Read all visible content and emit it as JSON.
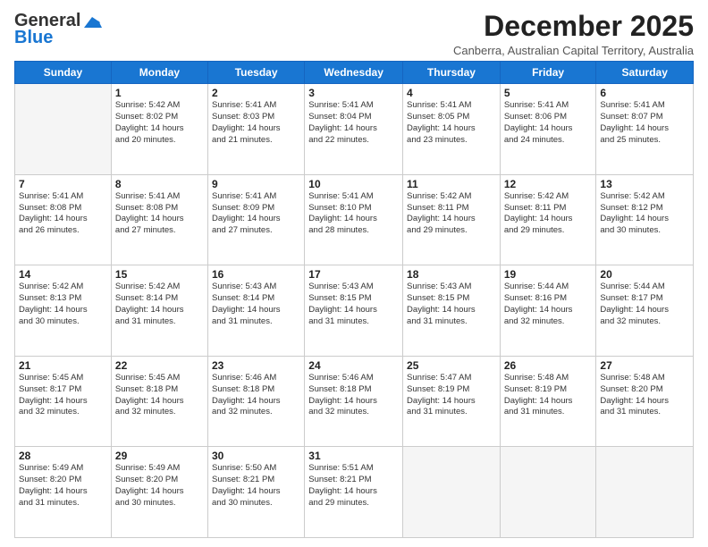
{
  "logo": {
    "line1": "General",
    "line2": "Blue"
  },
  "title": "December 2025",
  "subtitle": "Canberra, Australian Capital Territory, Australia",
  "days_header": [
    "Sunday",
    "Monday",
    "Tuesday",
    "Wednesday",
    "Thursday",
    "Friday",
    "Saturday"
  ],
  "weeks": [
    [
      {
        "day": "",
        "info": ""
      },
      {
        "day": "1",
        "info": "Sunrise: 5:42 AM\nSunset: 8:02 PM\nDaylight: 14 hours\nand 20 minutes."
      },
      {
        "day": "2",
        "info": "Sunrise: 5:41 AM\nSunset: 8:03 PM\nDaylight: 14 hours\nand 21 minutes."
      },
      {
        "day": "3",
        "info": "Sunrise: 5:41 AM\nSunset: 8:04 PM\nDaylight: 14 hours\nand 22 minutes."
      },
      {
        "day": "4",
        "info": "Sunrise: 5:41 AM\nSunset: 8:05 PM\nDaylight: 14 hours\nand 23 minutes."
      },
      {
        "day": "5",
        "info": "Sunrise: 5:41 AM\nSunset: 8:06 PM\nDaylight: 14 hours\nand 24 minutes."
      },
      {
        "day": "6",
        "info": "Sunrise: 5:41 AM\nSunset: 8:07 PM\nDaylight: 14 hours\nand 25 minutes."
      }
    ],
    [
      {
        "day": "7",
        "info": "Sunrise: 5:41 AM\nSunset: 8:08 PM\nDaylight: 14 hours\nand 26 minutes."
      },
      {
        "day": "8",
        "info": "Sunrise: 5:41 AM\nSunset: 8:08 PM\nDaylight: 14 hours\nand 27 minutes."
      },
      {
        "day": "9",
        "info": "Sunrise: 5:41 AM\nSunset: 8:09 PM\nDaylight: 14 hours\nand 27 minutes."
      },
      {
        "day": "10",
        "info": "Sunrise: 5:41 AM\nSunset: 8:10 PM\nDaylight: 14 hours\nand 28 minutes."
      },
      {
        "day": "11",
        "info": "Sunrise: 5:42 AM\nSunset: 8:11 PM\nDaylight: 14 hours\nand 29 minutes."
      },
      {
        "day": "12",
        "info": "Sunrise: 5:42 AM\nSunset: 8:11 PM\nDaylight: 14 hours\nand 29 minutes."
      },
      {
        "day": "13",
        "info": "Sunrise: 5:42 AM\nSunset: 8:12 PM\nDaylight: 14 hours\nand 30 minutes."
      }
    ],
    [
      {
        "day": "14",
        "info": "Sunrise: 5:42 AM\nSunset: 8:13 PM\nDaylight: 14 hours\nand 30 minutes."
      },
      {
        "day": "15",
        "info": "Sunrise: 5:42 AM\nSunset: 8:14 PM\nDaylight: 14 hours\nand 31 minutes."
      },
      {
        "day": "16",
        "info": "Sunrise: 5:43 AM\nSunset: 8:14 PM\nDaylight: 14 hours\nand 31 minutes."
      },
      {
        "day": "17",
        "info": "Sunrise: 5:43 AM\nSunset: 8:15 PM\nDaylight: 14 hours\nand 31 minutes."
      },
      {
        "day": "18",
        "info": "Sunrise: 5:43 AM\nSunset: 8:15 PM\nDaylight: 14 hours\nand 31 minutes."
      },
      {
        "day": "19",
        "info": "Sunrise: 5:44 AM\nSunset: 8:16 PM\nDaylight: 14 hours\nand 32 minutes."
      },
      {
        "day": "20",
        "info": "Sunrise: 5:44 AM\nSunset: 8:17 PM\nDaylight: 14 hours\nand 32 minutes."
      }
    ],
    [
      {
        "day": "21",
        "info": "Sunrise: 5:45 AM\nSunset: 8:17 PM\nDaylight: 14 hours\nand 32 minutes."
      },
      {
        "day": "22",
        "info": "Sunrise: 5:45 AM\nSunset: 8:18 PM\nDaylight: 14 hours\nand 32 minutes."
      },
      {
        "day": "23",
        "info": "Sunrise: 5:46 AM\nSunset: 8:18 PM\nDaylight: 14 hours\nand 32 minutes."
      },
      {
        "day": "24",
        "info": "Sunrise: 5:46 AM\nSunset: 8:18 PM\nDaylight: 14 hours\nand 32 minutes."
      },
      {
        "day": "25",
        "info": "Sunrise: 5:47 AM\nSunset: 8:19 PM\nDaylight: 14 hours\nand 31 minutes."
      },
      {
        "day": "26",
        "info": "Sunrise: 5:48 AM\nSunset: 8:19 PM\nDaylight: 14 hours\nand 31 minutes."
      },
      {
        "day": "27",
        "info": "Sunrise: 5:48 AM\nSunset: 8:20 PM\nDaylight: 14 hours\nand 31 minutes."
      }
    ],
    [
      {
        "day": "28",
        "info": "Sunrise: 5:49 AM\nSunset: 8:20 PM\nDaylight: 14 hours\nand 31 minutes."
      },
      {
        "day": "29",
        "info": "Sunrise: 5:49 AM\nSunset: 8:20 PM\nDaylight: 14 hours\nand 30 minutes."
      },
      {
        "day": "30",
        "info": "Sunrise: 5:50 AM\nSunset: 8:21 PM\nDaylight: 14 hours\nand 30 minutes."
      },
      {
        "day": "31",
        "info": "Sunrise: 5:51 AM\nSunset: 8:21 PM\nDaylight: 14 hours\nand 29 minutes."
      },
      {
        "day": "",
        "info": ""
      },
      {
        "day": "",
        "info": ""
      },
      {
        "day": "",
        "info": ""
      }
    ]
  ]
}
